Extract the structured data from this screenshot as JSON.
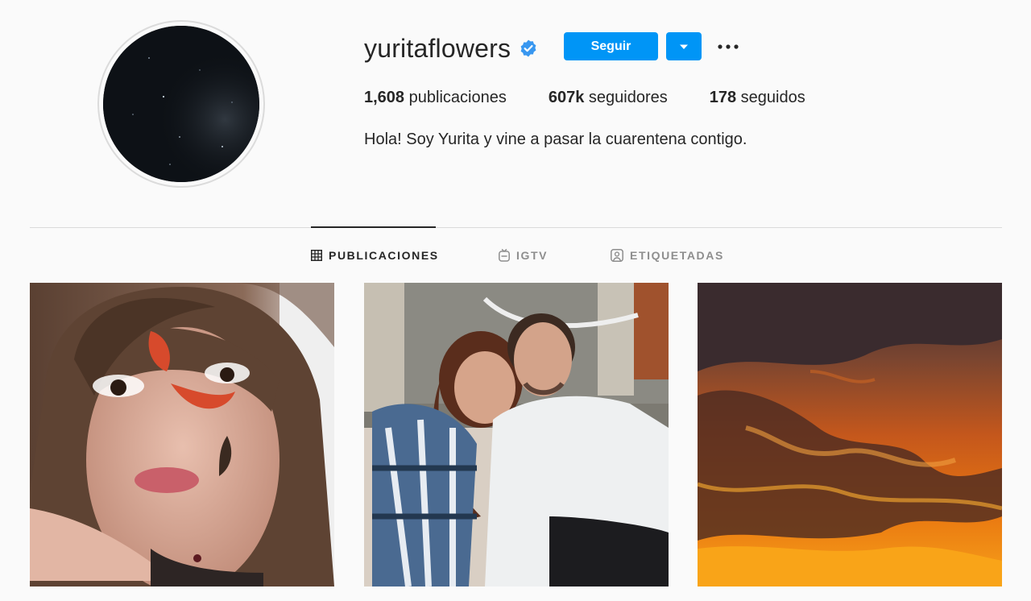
{
  "profile": {
    "username": "yuritaflowers",
    "verified": true,
    "follow_label": "Seguir",
    "stats": {
      "posts_count": "1,608",
      "posts_label": "publicaciones",
      "followers_count": "607k",
      "followers_label": "seguidores",
      "following_count": "178",
      "following_label": "seguidos"
    },
    "bio": "Hola! Soy Yurita y vine a pasar la cuarentena contigo."
  },
  "tabs": [
    {
      "label": "PUBLICACIONES",
      "icon": "grid-icon",
      "active": true
    },
    {
      "label": "IGTV",
      "icon": "igtv-icon",
      "active": false
    },
    {
      "label": "ETIQUETADAS",
      "icon": "tagged-icon",
      "active": false
    }
  ],
  "posts": [
    {
      "kind": "selfie-koi-filter"
    },
    {
      "kind": "couple-photo"
    },
    {
      "kind": "sunset-clouds"
    }
  ],
  "colors": {
    "accent": "#0095f6",
    "verified_badge": "#3897f0",
    "text": "#262626",
    "muted": "#8e8e8e",
    "border": "#dbdbdb",
    "background": "#fafafa"
  }
}
